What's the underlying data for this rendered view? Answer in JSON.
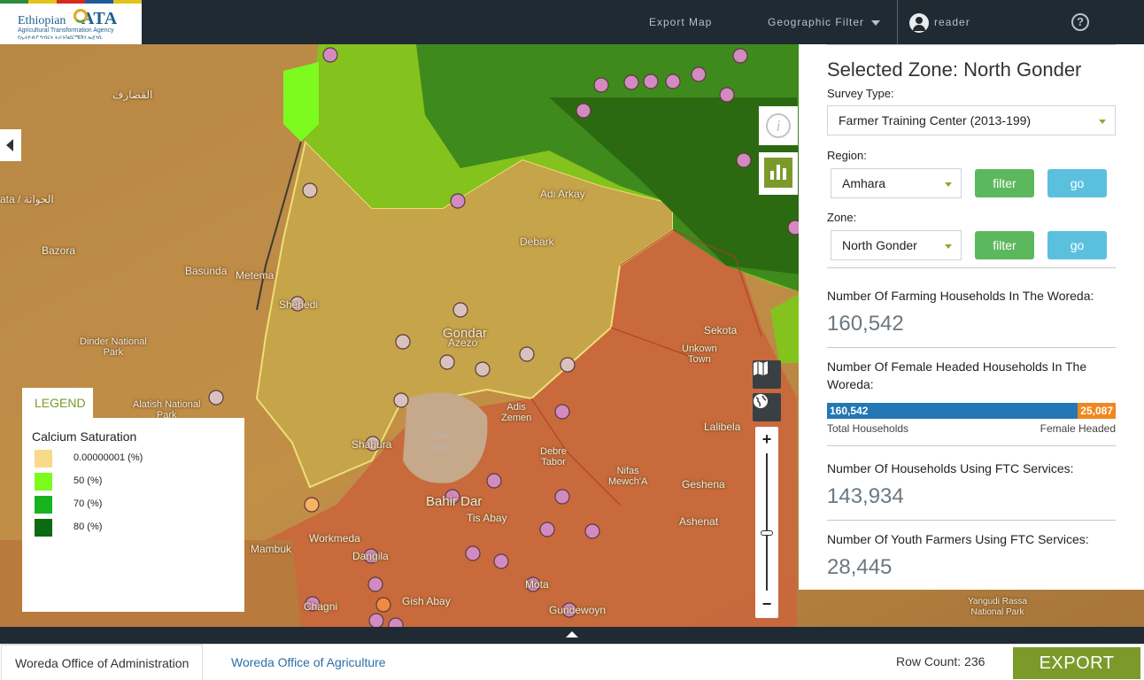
{
  "header": {
    "logo": {
      "name": "Ethiopian",
      "acronym": "ATA",
      "subtitle": "Agricultural Transformation Agency",
      "amharic": "የኢትዮጵያ ግብርና ትራንስፎርሜሽን ኤጀንሲ"
    },
    "nav": {
      "export_map": "Export Map",
      "geographic_filter": "Geographic Filter",
      "user": "reader",
      "help": "?"
    },
    "stripe_colors": [
      "#2e8b3d",
      "#e3c21a",
      "#d62a1f",
      "#1f5a9c",
      "#e3c21a"
    ]
  },
  "map": {
    "labels": {
      "gedaref": "القضارف",
      "hawata": "ata / الحواتة",
      "bazora": "Bazora",
      "basunda": "Basunda",
      "metema": "Metema",
      "shehedi": "Shehedi",
      "dinder": "Dinder National\nPark",
      "alatish": "Alatish National\nPark",
      "adi_arkay": "Adi Arkay",
      "debark": "Debark",
      "gondar": "Gondar",
      "azezo": "Azezo",
      "sekota": "Sekota",
      "unkown_town": "Unkown\nTown",
      "adis_zemen": "Adis\nZemen",
      "lalibela": "Lalibela",
      "tana_hayk": "Tana\nHayk",
      "shahura": "Shahura",
      "debre_tabor": "Debre\nTabor",
      "nifas_mewcha": "Nifas\nMewch'A",
      "geshena": "Geshena",
      "bahir_dar": "Bahir Dar",
      "tis_abay": "Tis Abay",
      "ashenat": "Ashenat",
      "workmeda": "Workmeda",
      "mambuk": "Mambuk",
      "dangila": "Dangila",
      "gish_abay": "Gish Abay",
      "mota": "Mota",
      "chagni": "Chagni",
      "gundewoyn": "Gundewoyn",
      "yangudi": "Yangudi Rassa\nNational Park"
    },
    "info_icon": "i",
    "zoom_in": "+",
    "zoom_out": "−",
    "zoom_level": 0.42
  },
  "legend": {
    "tab": "LEGEND",
    "title": "Calcium Saturation",
    "items": [
      {
        "label": "0.00000001 (%)",
        "color": "#f9d98a"
      },
      {
        "label": "50 (%)",
        "color": "#7dfa1e"
      },
      {
        "label": "70 (%)",
        "color": "#18b31e"
      },
      {
        "label": "80 (%)",
        "color": "#0c6a12"
      }
    ]
  },
  "panel": {
    "title": "Selected Zone: North Gonder",
    "survey_label": "Survey Type:",
    "survey_value": "Farmer Training Center (2013-199)",
    "region_label": "Region:",
    "region_value": "Amhara",
    "zone_label": "Zone:",
    "zone_value": "North Gonder",
    "filter_label": "filter",
    "go_label": "go",
    "stats": {
      "farming_households_label": "Number Of Farming Households In The Woreda:",
      "farming_households_value": "160,542",
      "female_headed_label": "Number Of Female Headed Households In The Woreda:",
      "bar_total": "160,542",
      "bar_female": "25,087",
      "bar_total_caption": "Total Households",
      "bar_female_caption": "Female Headed",
      "ftc_label": "Number Of Households Using FTC Services:",
      "ftc_value": "143,934",
      "youth_label": "Number Of Youth Farmers Using FTC Services:",
      "youth_value": "28,445"
    },
    "colors": {
      "bar_total": "#2277b4",
      "bar_female": "#f0871e",
      "filter": "#5cb85c",
      "go": "#5bc0de",
      "accent": "#7c9a2a"
    }
  },
  "bottom": {
    "tab_admin": "Woreda Office of Administration",
    "tab_agriculture": "Woreda Office of Agriculture",
    "row_count": "Row Count: 236",
    "export": "EXPORT"
  }
}
